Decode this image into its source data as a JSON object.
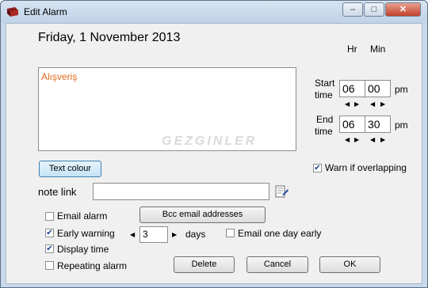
{
  "window": {
    "title": "Edit Alarm",
    "controls": {
      "minimize": "–",
      "maximize": "□",
      "close": "✕"
    }
  },
  "header": {
    "date": "Friday, 1 November 2013"
  },
  "notes": {
    "text": "Alışveriş",
    "text_color": "#e06b1f"
  },
  "watermark": {
    "text": "GEZGINLER"
  },
  "time": {
    "hr_label": "Hr",
    "min_label": "Min",
    "start": {
      "label_line1": "Start",
      "label_line2": "time",
      "hour": "06",
      "minute": "00",
      "ampm": "pm"
    },
    "end": {
      "label_line1": "End",
      "label_line2": "time",
      "hour": "06",
      "minute": "30",
      "ampm": "pm"
    }
  },
  "buttons": {
    "text_colour": "Text colour",
    "bcc": "Bcc email addresses",
    "delete": "Delete",
    "cancel": "Cancel",
    "ok": "OK"
  },
  "note_link": {
    "label": "note link",
    "value": ""
  },
  "options": {
    "warn_overlap": {
      "label": "Warn if overlapping",
      "checked": true
    },
    "email_alarm": {
      "label": "Email alarm",
      "checked": false
    },
    "early_warning": {
      "label": "Early warning",
      "checked": true,
      "days_value": "3",
      "days_label": "days"
    },
    "email_day_early": {
      "label": "Email one day early",
      "checked": false
    },
    "display_time": {
      "label": "Display time",
      "checked": true
    },
    "repeating": {
      "label": "Repeating alarm",
      "checked": false
    }
  },
  "colors": {
    "accent": "#3c7fb1",
    "titlebar": "#c9d9ea",
    "close": "#c4412b"
  }
}
